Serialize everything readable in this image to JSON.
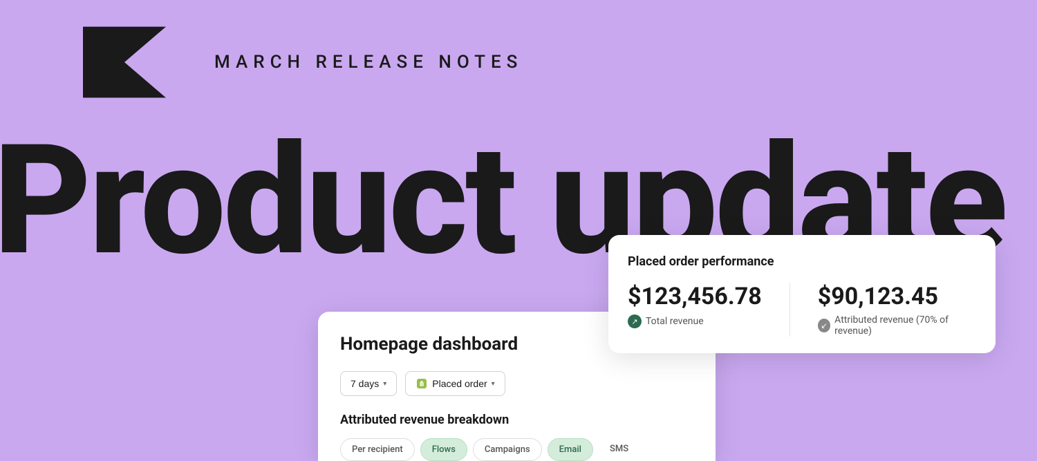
{
  "background_color": "#c9a8f0",
  "header": {
    "release_title": "MARCH  RELEASE  NOTES"
  },
  "hero": {
    "text": "Product update"
  },
  "dashboard_card": {
    "title": "Homepage dashboard",
    "filter_days": {
      "label": "7 days",
      "chevron": "▾"
    },
    "filter_event": {
      "label": "Placed order",
      "chevron": "▾"
    },
    "section_label": "Attributed revenue breakdown",
    "tabs": [
      {
        "label": "Per recipient",
        "style": "per-recipient"
      },
      {
        "label": "Flows",
        "style": "flows"
      },
      {
        "label": "Campaigns",
        "style": "campaigns"
      },
      {
        "label": "Email",
        "style": "email"
      },
      {
        "label": "SMS",
        "style": "sms"
      }
    ]
  },
  "performance_card": {
    "title": "Placed order performance",
    "metrics": [
      {
        "value": "$123,456.78",
        "label": "Total revenue",
        "icon_type": "green",
        "icon_char": "↗"
      },
      {
        "value": "$90,123.45",
        "label": "Attributed revenue (70% of revenue)",
        "icon_type": "gray",
        "icon_char": "↙"
      }
    ]
  }
}
